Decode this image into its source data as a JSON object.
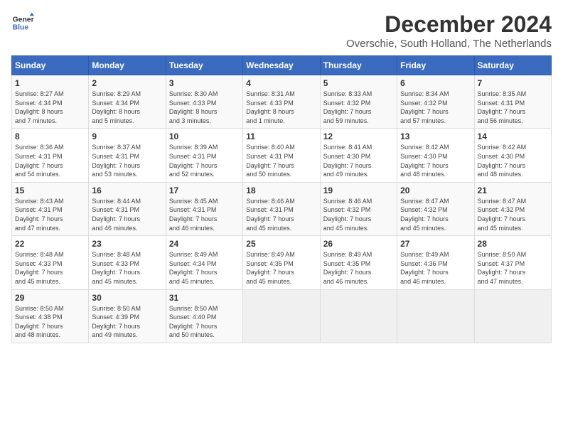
{
  "header": {
    "logo_line1": "General",
    "logo_line2": "Blue",
    "title": "December 2024",
    "subtitle": "Overschie, South Holland, The Netherlands"
  },
  "calendar": {
    "days_of_week": [
      "Sunday",
      "Monday",
      "Tuesday",
      "Wednesday",
      "Thursday",
      "Friday",
      "Saturday"
    ],
    "weeks": [
      [
        {
          "day": "1",
          "detail": "Sunrise: 8:27 AM\nSunset: 4:34 PM\nDaylight: 8 hours\nand 7 minutes."
        },
        {
          "day": "2",
          "detail": "Sunrise: 8:29 AM\nSunset: 4:34 PM\nDaylight: 8 hours\nand 5 minutes."
        },
        {
          "day": "3",
          "detail": "Sunrise: 8:30 AM\nSunset: 4:33 PM\nDaylight: 8 hours\nand 3 minutes."
        },
        {
          "day": "4",
          "detail": "Sunrise: 8:31 AM\nSunset: 4:33 PM\nDaylight: 8 hours\nand 1 minute."
        },
        {
          "day": "5",
          "detail": "Sunrise: 8:33 AM\nSunset: 4:32 PM\nDaylight: 7 hours\nand 59 minutes."
        },
        {
          "day": "6",
          "detail": "Sunrise: 8:34 AM\nSunset: 4:32 PM\nDaylight: 7 hours\nand 57 minutes."
        },
        {
          "day": "7",
          "detail": "Sunrise: 8:35 AM\nSunset: 4:31 PM\nDaylight: 7 hours\nand 56 minutes."
        }
      ],
      [
        {
          "day": "8",
          "detail": "Sunrise: 8:36 AM\nSunset: 4:31 PM\nDaylight: 7 hours\nand 54 minutes."
        },
        {
          "day": "9",
          "detail": "Sunrise: 8:37 AM\nSunset: 4:31 PM\nDaylight: 7 hours\nand 53 minutes."
        },
        {
          "day": "10",
          "detail": "Sunrise: 8:39 AM\nSunset: 4:31 PM\nDaylight: 7 hours\nand 52 minutes."
        },
        {
          "day": "11",
          "detail": "Sunrise: 8:40 AM\nSunset: 4:31 PM\nDaylight: 7 hours\nand 50 minutes."
        },
        {
          "day": "12",
          "detail": "Sunrise: 8:41 AM\nSunset: 4:30 PM\nDaylight: 7 hours\nand 49 minutes."
        },
        {
          "day": "13",
          "detail": "Sunrise: 8:42 AM\nSunset: 4:30 PM\nDaylight: 7 hours\nand 48 minutes."
        },
        {
          "day": "14",
          "detail": "Sunrise: 8:42 AM\nSunset: 4:30 PM\nDaylight: 7 hours\nand 48 minutes."
        }
      ],
      [
        {
          "day": "15",
          "detail": "Sunrise: 8:43 AM\nSunset: 4:31 PM\nDaylight: 7 hours\nand 47 minutes."
        },
        {
          "day": "16",
          "detail": "Sunrise: 8:44 AM\nSunset: 4:31 PM\nDaylight: 7 hours\nand 46 minutes."
        },
        {
          "day": "17",
          "detail": "Sunrise: 8:45 AM\nSunset: 4:31 PM\nDaylight: 7 hours\nand 46 minutes."
        },
        {
          "day": "18",
          "detail": "Sunrise: 8:46 AM\nSunset: 4:31 PM\nDaylight: 7 hours\nand 45 minutes."
        },
        {
          "day": "19",
          "detail": "Sunrise: 8:46 AM\nSunset: 4:32 PM\nDaylight: 7 hours\nand 45 minutes."
        },
        {
          "day": "20",
          "detail": "Sunrise: 8:47 AM\nSunset: 4:32 PM\nDaylight: 7 hours\nand 45 minutes."
        },
        {
          "day": "21",
          "detail": "Sunrise: 8:47 AM\nSunset: 4:32 PM\nDaylight: 7 hours\nand 45 minutes."
        }
      ],
      [
        {
          "day": "22",
          "detail": "Sunrise: 8:48 AM\nSunset: 4:33 PM\nDaylight: 7 hours\nand 45 minutes."
        },
        {
          "day": "23",
          "detail": "Sunrise: 8:48 AM\nSunset: 4:33 PM\nDaylight: 7 hours\nand 45 minutes."
        },
        {
          "day": "24",
          "detail": "Sunrise: 8:49 AM\nSunset: 4:34 PM\nDaylight: 7 hours\nand 45 minutes."
        },
        {
          "day": "25",
          "detail": "Sunrise: 8:49 AM\nSunset: 4:35 PM\nDaylight: 7 hours\nand 45 minutes."
        },
        {
          "day": "26",
          "detail": "Sunrise: 8:49 AM\nSunset: 4:35 PM\nDaylight: 7 hours\nand 46 minutes."
        },
        {
          "day": "27",
          "detail": "Sunrise: 8:49 AM\nSunset: 4:36 PM\nDaylight: 7 hours\nand 46 minutes."
        },
        {
          "day": "28",
          "detail": "Sunrise: 8:50 AM\nSunset: 4:37 PM\nDaylight: 7 hours\nand 47 minutes."
        }
      ],
      [
        {
          "day": "29",
          "detail": "Sunrise: 8:50 AM\nSunset: 4:38 PM\nDaylight: 7 hours\nand 48 minutes."
        },
        {
          "day": "30",
          "detail": "Sunrise: 8:50 AM\nSunset: 4:39 PM\nDaylight: 7 hours\nand 49 minutes."
        },
        {
          "day": "31",
          "detail": "Sunrise: 8:50 AM\nSunset: 4:40 PM\nDaylight: 7 hours\nand 50 minutes."
        },
        {
          "day": "",
          "detail": ""
        },
        {
          "day": "",
          "detail": ""
        },
        {
          "day": "",
          "detail": ""
        },
        {
          "day": "",
          "detail": ""
        }
      ]
    ]
  }
}
